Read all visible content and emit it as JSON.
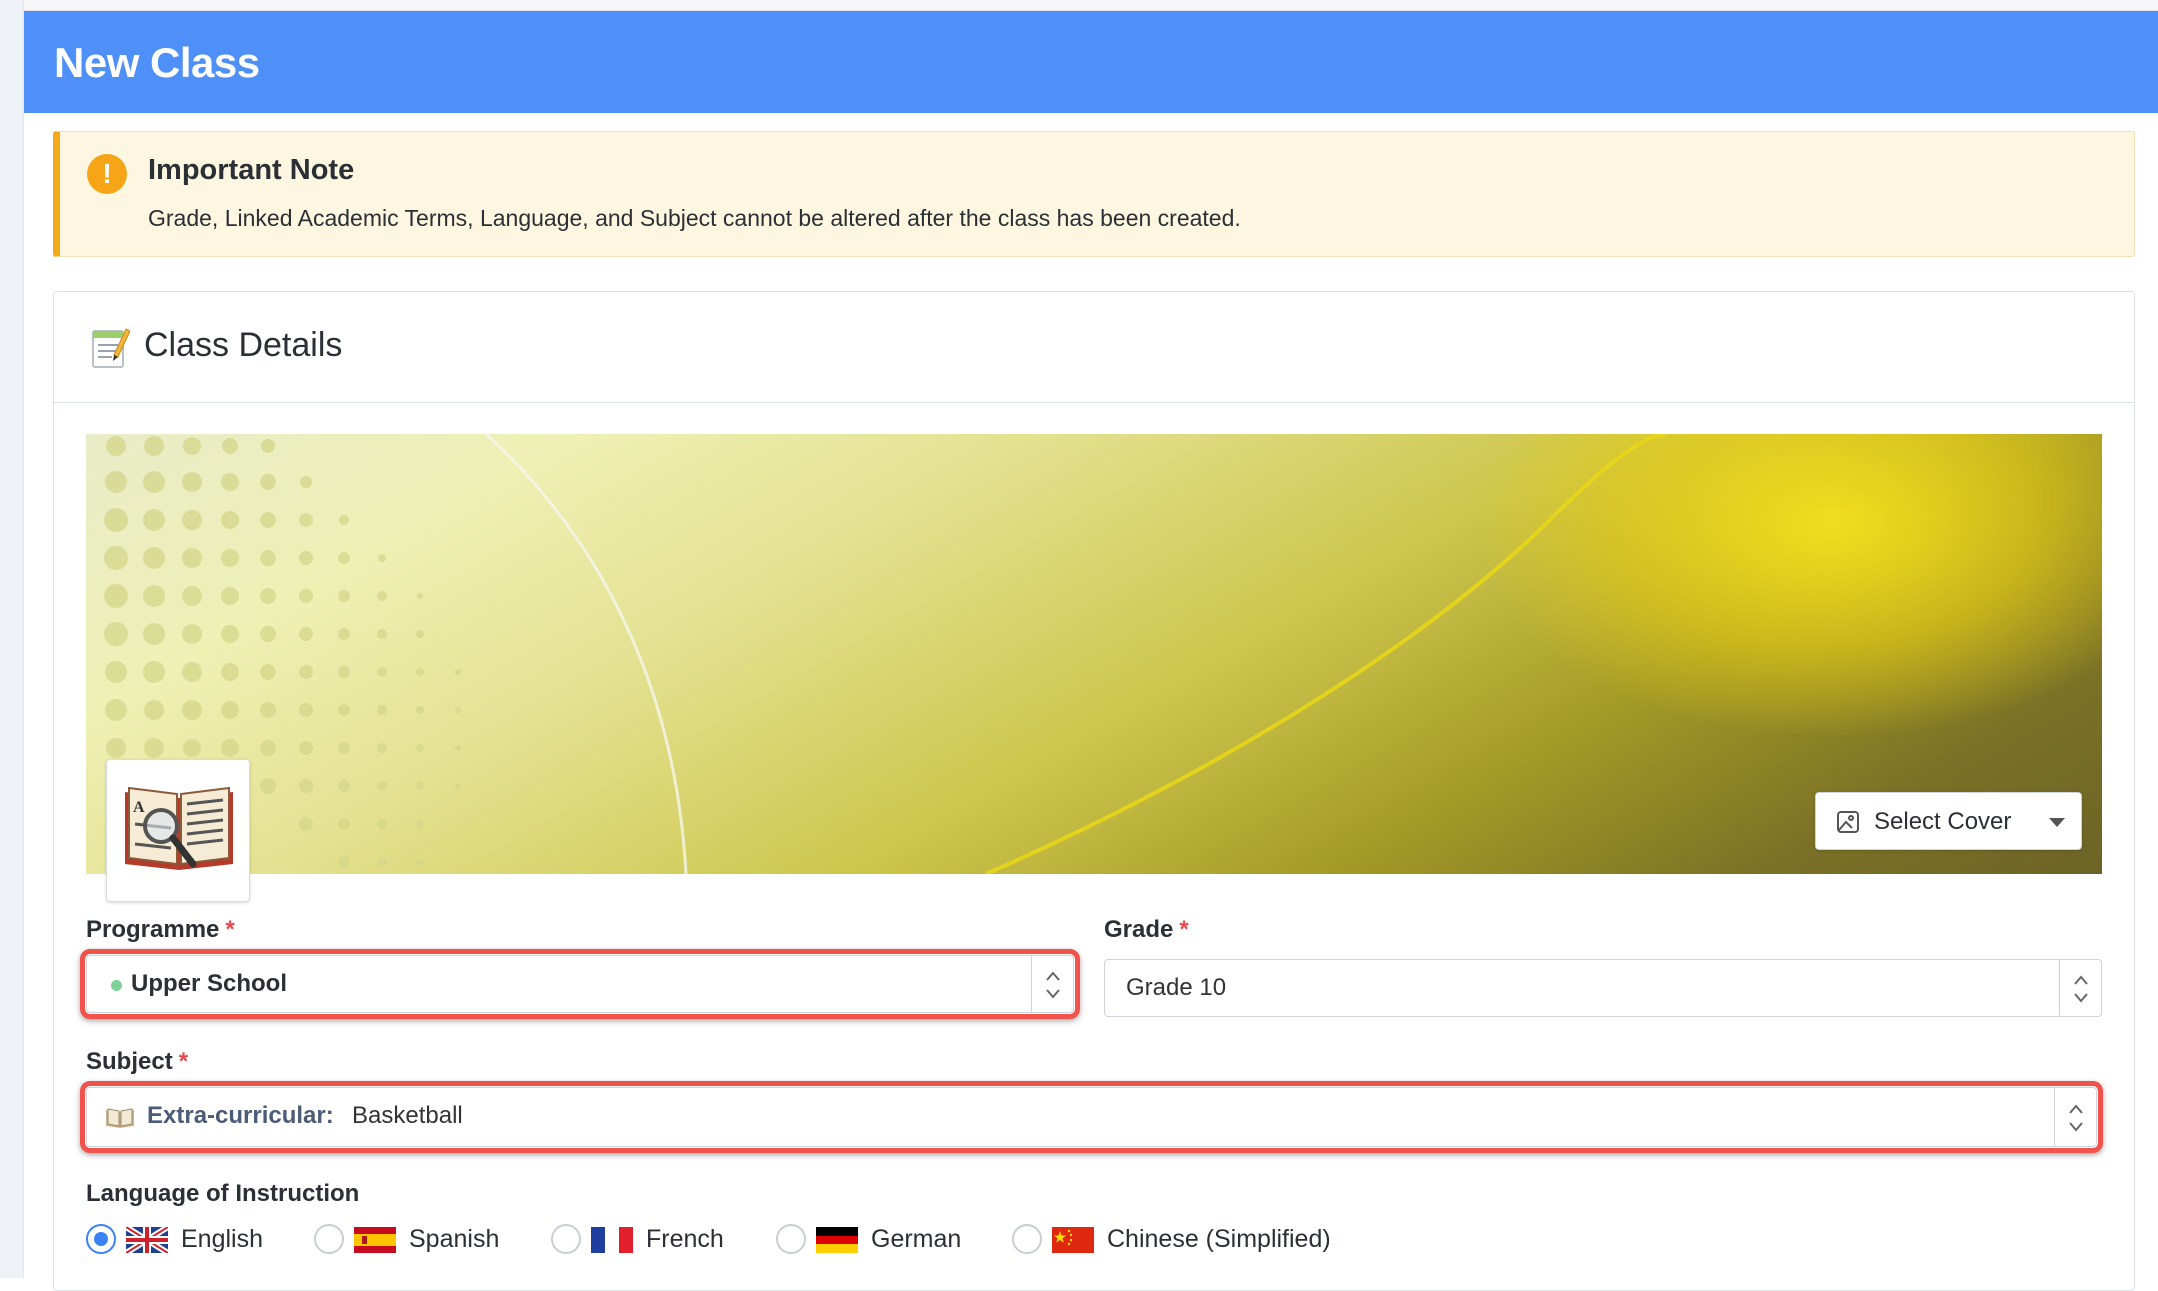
{
  "header": {
    "title": "New Class"
  },
  "note": {
    "title": "Important Note",
    "text": "Grade, Linked Academic Terms, Language, and Subject cannot be altered after the class has been created."
  },
  "card": {
    "title": "Class Details"
  },
  "cover": {
    "select_label": "Select Cover"
  },
  "programme": {
    "label": "Programme",
    "required_mark": "*",
    "value": "Upper School"
  },
  "grade": {
    "label": "Grade",
    "required_mark": "*",
    "value": "Grade 10"
  },
  "subject": {
    "label": "Subject",
    "required_mark": "*",
    "category": "Extra-curricular:",
    "value": "Basketball"
  },
  "language": {
    "label": "Language of Instruction",
    "options": [
      {
        "label": "English",
        "flag": "uk-flag",
        "selected": true
      },
      {
        "label": "Spanish",
        "flag": "spain-flag",
        "selected": false
      },
      {
        "label": "French",
        "flag": "france-flag",
        "selected": false
      },
      {
        "label": "German",
        "flag": "germany-flag",
        "selected": false
      },
      {
        "label": "Chinese (Simplified)",
        "flag": "china-flag",
        "selected": false
      }
    ]
  },
  "colors": {
    "header": "#4e8ff8",
    "warning": "#f4a91b",
    "highlight": "#f0534c",
    "radio_selected": "#3b82f6"
  }
}
